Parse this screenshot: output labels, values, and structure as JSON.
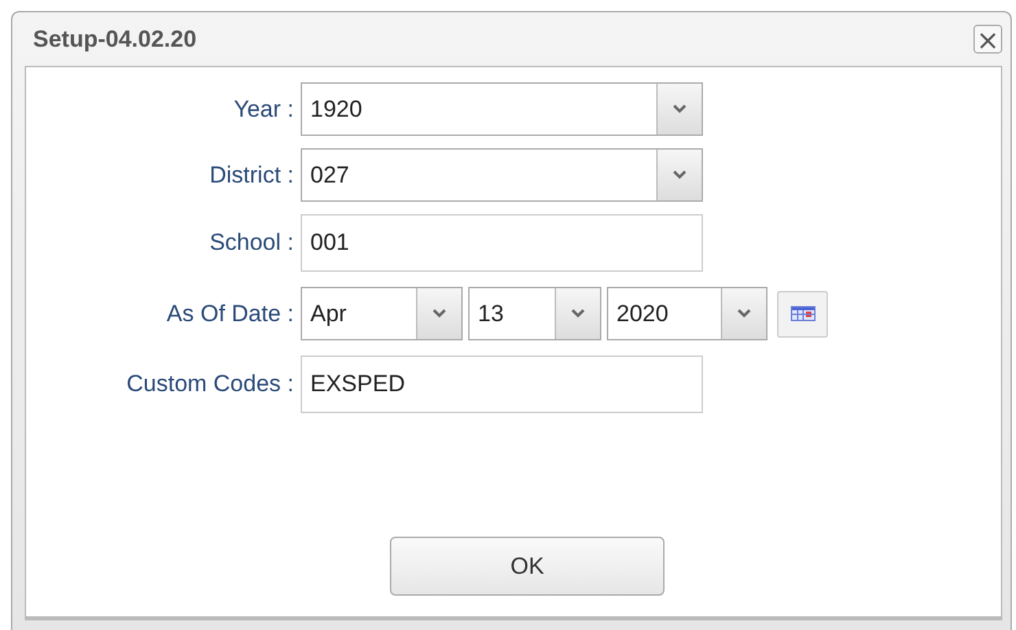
{
  "window": {
    "title": "Setup-04.02.20",
    "close": "×"
  },
  "fields": [
    {
      "kind": "select",
      "label": "Year :",
      "value": "1920"
    },
    {
      "kind": "select",
      "label": "District :",
      "value": "027"
    },
    {
      "kind": "input",
      "label": "School :",
      "value": "001"
    },
    {
      "kind": "date",
      "label": "As Of Date :",
      "parts": [
        "Apr",
        "13",
        "2020"
      ]
    },
    {
      "kind": "input",
      "label": "Custom Codes :",
      "value": "EXSPED"
    }
  ],
  "buttons": [
    "OK"
  ]
}
